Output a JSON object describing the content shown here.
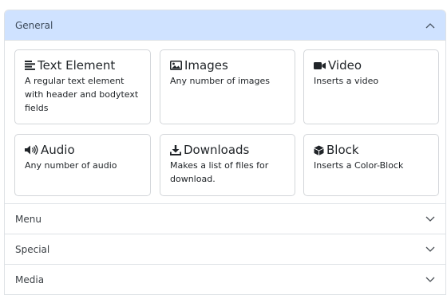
{
  "sections": {
    "general": {
      "label": "General",
      "expanded": true
    },
    "menu": {
      "label": "Menu"
    },
    "special": {
      "label": "Special"
    },
    "media": {
      "label": "Media"
    }
  },
  "elements": [
    {
      "title": "Text Element",
      "description": "A regular text element with header and bodytext fields",
      "icon": "text-icon"
    },
    {
      "title": "Images",
      "description": "Any number of images",
      "icon": "image-icon"
    },
    {
      "title": "Video",
      "description": "Inserts a video",
      "icon": "video-icon"
    },
    {
      "title": "Audio",
      "description": "Any number of audio",
      "icon": "audio-icon"
    },
    {
      "title": "Downloads",
      "description": "Makes a list of files for download.",
      "icon": "download-icon"
    },
    {
      "title": "Block",
      "description": "Inserts a Color-Block",
      "icon": "cube-icon"
    }
  ],
  "colors": {
    "header_active_bg": "#cfe2ff",
    "border": "#dee2e6"
  }
}
